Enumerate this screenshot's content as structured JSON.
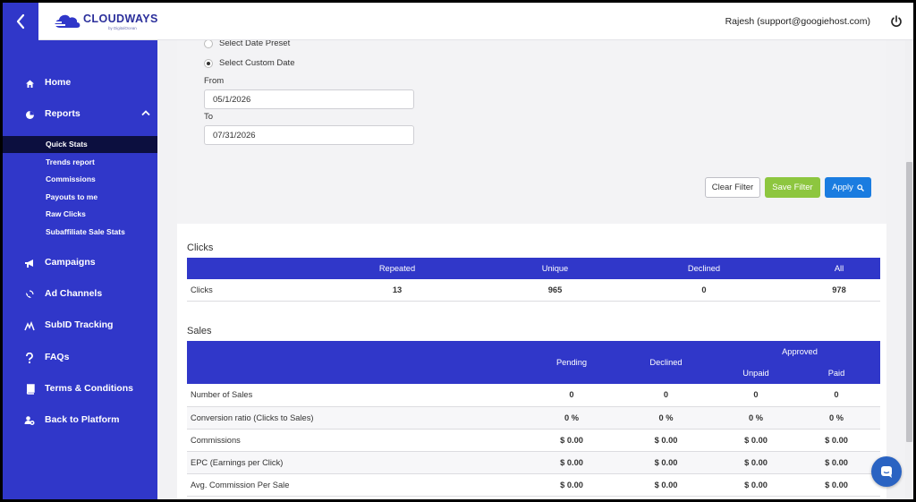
{
  "header": {
    "logo_text": "CLOUDWAYS",
    "logo_sub": "by DigitalOcean",
    "user": "Rajesh (support@googiehost.com)"
  },
  "sidebar": {
    "items": [
      {
        "label": "Home",
        "icon": "home-icon"
      },
      {
        "label": "Reports",
        "icon": "pie-chart-icon"
      },
      {
        "label": "Campaigns",
        "icon": "megaphone-icon"
      },
      {
        "label": "Ad Channels",
        "icon": "satellite-icon"
      },
      {
        "label": "SubID Tracking",
        "icon": "tracking-icon"
      },
      {
        "label": "FAQs",
        "icon": "question-icon"
      },
      {
        "label": "Terms & Conditions",
        "icon": "book-icon"
      },
      {
        "label": "Back to Platform",
        "icon": "users-icon"
      }
    ],
    "reports_sub": [
      {
        "label": "Quick Stats",
        "active": true
      },
      {
        "label": "Trends report"
      },
      {
        "label": "Commissions"
      },
      {
        "label": "Payouts to me"
      },
      {
        "label": "Raw Clicks"
      },
      {
        "label": "Subaffiliate Sale Stats"
      }
    ]
  },
  "filter": {
    "preset_label": "Select Date Preset",
    "custom_label": "Select Custom Date",
    "from_label": "From",
    "from_value": "05/1/2026",
    "to_label": "To",
    "to_value": "07/31/2026",
    "clear_label": "Clear Filter",
    "save_label": "Save Filter",
    "apply_label": "Apply"
  },
  "clicks": {
    "title": "Clicks",
    "headers": [
      "",
      "Repeated",
      "Unique",
      "Declined",
      "All"
    ],
    "row": {
      "label": "Clicks",
      "values": [
        "13",
        "965",
        "0",
        "978"
      ]
    }
  },
  "sales": {
    "title": "Sales",
    "headers": {
      "pending": "Pending",
      "declined": "Declined",
      "approved": "Approved",
      "unpaid": "Unpaid",
      "paid": "Paid"
    },
    "rows": [
      {
        "label": "Number of Sales",
        "values": [
          "0",
          "0",
          "0",
          "0"
        ]
      },
      {
        "label": "Conversion ratio (Clicks to Sales)",
        "values": [
          "0 %",
          "0 %",
          "0 %",
          "0 %"
        ]
      },
      {
        "label": "Commissions",
        "values": [
          "$ 0.00",
          "$ 0.00",
          "$ 0.00",
          "$ 0.00"
        ]
      },
      {
        "label": "EPC (Earnings per Click)",
        "values": [
          "$ 0.00",
          "$ 0.00",
          "$ 0.00",
          "$ 0.00"
        ]
      },
      {
        "label": "Avg. Commission Per Sale",
        "values": [
          "$ 0.00",
          "$ 0.00",
          "$ 0.00",
          "$ 0.00"
        ]
      }
    ]
  },
  "colors": {
    "brand": "#3037c9",
    "active_sub": "#0c0f3f",
    "save": "#8dc63f",
    "apply": "#1a7ce0"
  }
}
